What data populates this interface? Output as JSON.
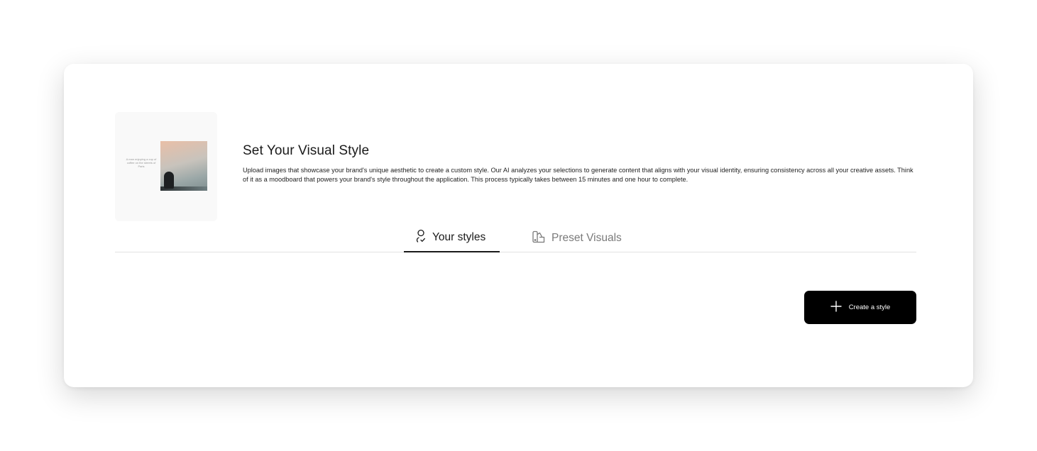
{
  "intro": {
    "thumbnail_caption": "A man enjoying a cup of coffee on the streets of Paris",
    "title": "Set Your Visual Style",
    "description": "Upload images that showcase your brand's unique aesthetic to create a custom style. Our AI analyzes your selections to generate content that aligns with your visual identity, ensuring consistency across all your creative assets. Think of it as a moodboard that powers your brand's style throughout the application. This process typically takes between 15 minutes and one hour to complete."
  },
  "tabs": [
    {
      "label": "Your styles",
      "icon": "user-check-icon",
      "active": true
    },
    {
      "label": "Preset Visuals",
      "icon": "palette-swatch-icon",
      "active": false
    }
  ],
  "actions": {
    "create_label": "Create a style",
    "create_icon": "plus-icon"
  },
  "colors": {
    "primary_button": "#000000",
    "active_tab": "#1a1a1a",
    "inactive_tab": "#7a7a7a"
  }
}
